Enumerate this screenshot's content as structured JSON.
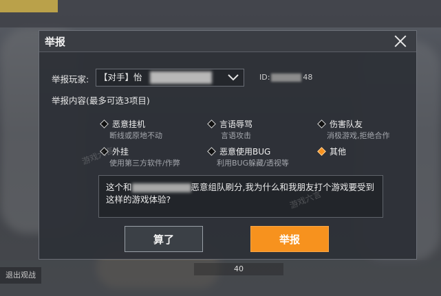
{
  "dialog": {
    "title": "举报",
    "player_label": "举报玩家:",
    "player_value": "【对手】",
    "player_value_tail": "怡",
    "player_id_prefix": "ID:",
    "player_id_suffix": "48",
    "content_label": "举报内容(最多可选3项目)",
    "options": [
      {
        "title": "恶意挂机",
        "desc": "断线或原地不动",
        "selected": false
      },
      {
        "title": "言语辱骂",
        "desc": "言语攻击",
        "selected": false
      },
      {
        "title": "伤害队友",
        "desc": "消极游戏,拒绝合作",
        "selected": false
      },
      {
        "title": "外挂",
        "desc": "使用第三方软件/作弊",
        "selected": false
      },
      {
        "title": "恶意使用BUG",
        "desc": "利用BUG躲藏/透视等",
        "selected": false
      },
      {
        "title": "其他",
        "desc": "",
        "selected": true
      }
    ],
    "text_before": "这个和",
    "text_after": "恶意组队刷分,我为什么和我朋友打个游戏要受到这样的游戏体验?",
    "cancel_label": "算了",
    "report_label": "举报"
  },
  "background": {
    "exit_label": "退出观战",
    "counter": "40"
  },
  "watermark": "游戏六言",
  "colors": {
    "accent": "#f7921e",
    "panel": "#2e3137",
    "border": "#6b6f77"
  }
}
